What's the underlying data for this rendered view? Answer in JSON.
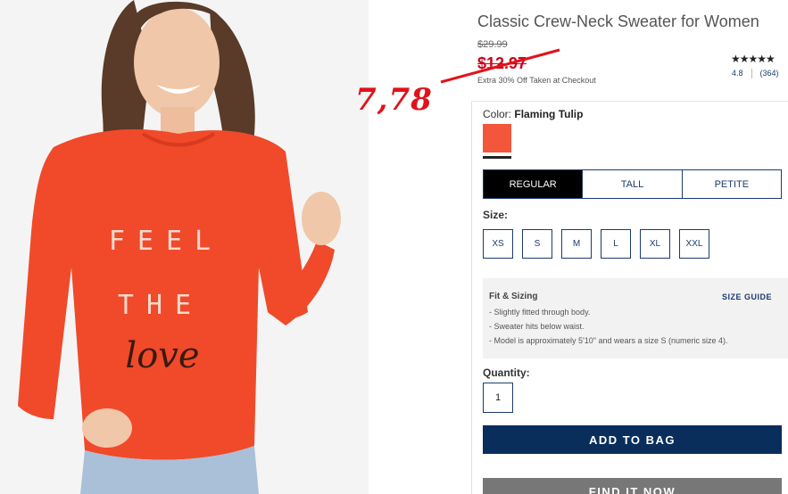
{
  "product": {
    "title": "Classic Crew-Neck Sweater for Women",
    "original_price": "$29.99",
    "sale_price": "$12.97",
    "promo": "Extra 30% Off Taken at Checkout",
    "stars": "★★★★★",
    "rating": "4.8",
    "review_count": "(364)"
  },
  "annotation": {
    "handwritten_price": "7,78",
    "color": "#e0131b"
  },
  "image": {
    "sweater_text_1": "FEEL",
    "sweater_text_2": "THE",
    "sweater_text_3": "love",
    "sweater_color": "#f04a2a"
  },
  "color": {
    "label": "Color:",
    "value": "Flaming Tulip",
    "swatch_hex": "#f4563b"
  },
  "fit_tabs": [
    {
      "label": "REGULAR",
      "active": true
    },
    {
      "label": "TALL",
      "active": false
    },
    {
      "label": "PETITE",
      "active": false
    }
  ],
  "size": {
    "label": "Size:",
    "options": [
      "XS",
      "S",
      "M",
      "L",
      "XL",
      "XXL"
    ]
  },
  "fit_sizing": {
    "title": "Fit & Sizing",
    "size_guide": "SIZE GUIDE",
    "items": [
      "- Slightly fitted through body.",
      "- Sweater hits below waist.",
      "- Model is approximately 5'10\" and wears a size S (numeric size 4)."
    ]
  },
  "quantity": {
    "label": "Quantity:",
    "value": "1"
  },
  "buttons": {
    "add_to_bag": "ADD TO BAG",
    "find_it_now": "FIND IT NOW"
  },
  "colors": {
    "brand_navy": "#0a2e5c",
    "link_blue": "#1a3c6e",
    "sale_red": "#d0011b"
  }
}
